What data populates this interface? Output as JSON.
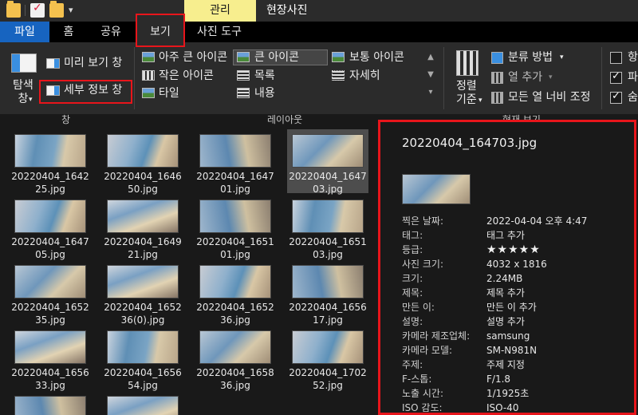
{
  "titlebar": {
    "context_tab": "관리",
    "context_title": "현장사진"
  },
  "tabs": [
    {
      "label": "파일"
    },
    {
      "label": "홈"
    },
    {
      "label": "공유"
    },
    {
      "label": "보기"
    },
    {
      "label": "사진 도구"
    }
  ],
  "ribbon": {
    "pane_group": {
      "navigation_pane": "탐색\n창",
      "preview_pane": "미리 보기 창",
      "details_pane": "세부 정보 창",
      "label": "창"
    },
    "layout_group": {
      "items": [
        "아주 큰 아이콘",
        "큰 아이콘",
        "보통 아이콘",
        "작은 아이콘",
        "목록",
        "자세히",
        "타일",
        "내용"
      ],
      "selected": "큰 아이콘",
      "label": "레이아웃"
    },
    "current_view_group": {
      "sort_by": "정렬\n기준",
      "group_by": "분류 방법",
      "add_columns": "열 추가",
      "size_all_columns": "모든 열 너비 조정",
      "label": "현재 보기"
    },
    "show_hide_group": {
      "checkboxes": [
        {
          "label": "항",
          "checked": false
        },
        {
          "label": "파",
          "checked": true
        },
        {
          "label": "숨",
          "checked": true
        }
      ]
    }
  },
  "files": [
    {
      "name": "20220404_164225.jpg",
      "selected": false
    },
    {
      "name": "20220404_164650.jpg",
      "selected": false
    },
    {
      "name": "20220404_164701.jpg",
      "selected": false
    },
    {
      "name": "20220404_164703.jpg",
      "selected": true
    },
    {
      "name": "20220404_164705.jpg",
      "selected": false
    },
    {
      "name": "20220404_164921.jpg",
      "selected": false
    },
    {
      "name": "20220404_165101.jpg",
      "selected": false
    },
    {
      "name": "20220404_165103.jpg",
      "selected": false
    },
    {
      "name": "20220404_165235.jpg",
      "selected": false
    },
    {
      "name": "20220404_165236(0).jpg",
      "selected": false
    },
    {
      "name": "20220404_165236.jpg",
      "selected": false
    },
    {
      "name": "20220404_165617.jpg",
      "selected": false
    },
    {
      "name": "20220404_165633.jpg",
      "selected": false
    },
    {
      "name": "20220404_165654.jpg",
      "selected": false
    },
    {
      "name": "20220404_165836.jpg",
      "selected": false
    },
    {
      "name": "20220404_170252.jpg",
      "selected": false
    }
  ],
  "details": {
    "filename": "20220404_164703.jpg",
    "rows": [
      {
        "key": "찍은 날짜:",
        "value": "2022-04-04 오후 4:47"
      },
      {
        "key": "태그:",
        "value": "태그 추가"
      },
      {
        "key": "등급:",
        "value": "★★★★★"
      },
      {
        "key": "사진 크기:",
        "value": "4032 x 1816"
      },
      {
        "key": "크기:",
        "value": "2.24MB"
      },
      {
        "key": "제목:",
        "value": "제목 추가"
      },
      {
        "key": "만든 이:",
        "value": "만든 이 추가"
      },
      {
        "key": "설명:",
        "value": "설명 추가"
      },
      {
        "key": "카메라 제조업체:",
        "value": "samsung"
      },
      {
        "key": "카메라 모델:",
        "value": "SM-N981N"
      },
      {
        "key": "주제:",
        "value": "주제 지정"
      },
      {
        "key": "F-스톱:",
        "value": "F/1.8"
      },
      {
        "key": "노출 시간:",
        "value": "1/1925초"
      },
      {
        "key": "ISO 감도:",
        "value": "ISO-40"
      }
    ]
  }
}
